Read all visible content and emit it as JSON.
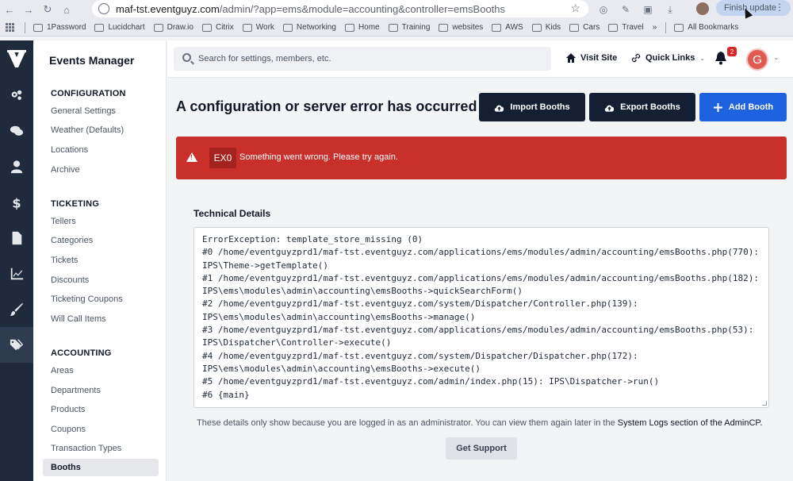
{
  "browser": {
    "url_host": "maf-tst.eventguyz.com",
    "url_path": "/admin/?app=ems&module=accounting&controller=emsBooths",
    "finish_update": "Finish update",
    "bookmarks": [
      "1Password",
      "Lucidchart",
      "Draw.io",
      "Citrix",
      "Work",
      "Networking",
      "Home",
      "Training",
      "websites",
      "AWS",
      "Kids",
      "Cars",
      "Travel"
    ],
    "all_bookmarks": "All Bookmarks",
    "more": "»"
  },
  "app": {
    "title": "Events Manager"
  },
  "sidebar": {
    "configuration": {
      "heading": "CONFIGURATION",
      "items": [
        "General Settings",
        "Weather (Defaults)",
        "Locations",
        "Archive"
      ]
    },
    "ticketing": {
      "heading": "TICKETING",
      "items": [
        "Tellers",
        "Categories",
        "Tickets",
        "Discounts",
        "Ticketing Coupons",
        "Will Call Items"
      ]
    },
    "accounting": {
      "heading": "ACCOUNTING",
      "items": [
        "Areas",
        "Departments",
        "Products",
        "Coupons",
        "Transaction Types"
      ],
      "active": "Booths"
    }
  },
  "header": {
    "search_placeholder": "Search for settings, members, etc.",
    "visit_site": "Visit Site",
    "quick_links": "Quick Links",
    "notification_count": "2",
    "avatar_letter": "G"
  },
  "main": {
    "title": "A configuration or server error has occurred",
    "import_label": "Import Booths",
    "export_label": "Export Booths",
    "add_label": "Add Booth",
    "error_code": "EX0",
    "error_message": "Something went wrong. Please try again.",
    "tech_title": "Technical Details",
    "trace": [
      "ErrorException: template_store_missing (0)",
      "#0 /home/eventguyzprd1/maf-tst.eventguyz.com/applications/ems/modules/admin/accounting/emsBooths.php(770):",
      "IPS\\Theme->getTemplate()",
      "#1 /home/eventguyzprd1/maf-tst.eventguyz.com/applications/ems/modules/admin/accounting/emsBooths.php(182):",
      "IPS\\ems\\modules\\admin\\accounting\\emsBooths->quickSearchForm()",
      "#2 /home/eventguyzprd1/maf-tst.eventguyz.com/system/Dispatcher/Controller.php(139):",
      "IPS\\ems\\modules\\admin\\accounting\\emsBooths->manage()",
      "#3 /home/eventguyzprd1/maf-tst.eventguyz.com/applications/ems/modules/admin/accounting/emsBooths.php(53):",
      "IPS\\Dispatcher\\Controller->execute()",
      "#4 /home/eventguyzprd1/maf-tst.eventguyz.com/system/Dispatcher/Dispatcher.php(172):",
      "IPS\\ems\\modules\\admin\\accounting\\emsBooths->execute()",
      "#5 /home/eventguyzprd1/maf-tst.eventguyz.com/admin/index.php(15): IPS\\Dispatcher->run()",
      "#6 {main}"
    ],
    "note_text": "These details only show because you are logged in as an administrator. You can view them again later in the ",
    "note_link": "System Logs section of the AdminCP.",
    "support_label": "Get Support"
  },
  "colors": {
    "error": "#c9302c",
    "dark_button": "#141f33",
    "primary": "#1e62e0",
    "rail": "#1f2a3a"
  }
}
